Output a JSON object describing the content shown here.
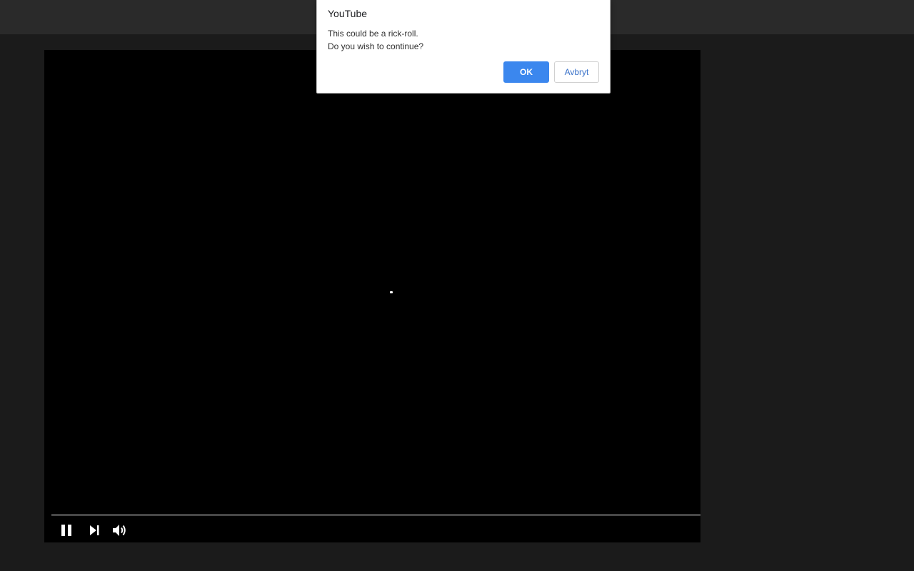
{
  "dialog": {
    "title": "YouTube",
    "message_line1": "This could be a rick-roll.",
    "message_line2": "Do you wish to continue?",
    "ok_label": "OK",
    "cancel_label": "Avbryt"
  },
  "player": {
    "progress_percent": 0,
    "controls": {
      "pause_icon": "pause-icon",
      "next_icon": "skip-next-icon",
      "volume_icon": "volume-icon"
    }
  },
  "colors": {
    "ok_button": "#3b87ee",
    "cancel_text": "#3871c9",
    "page_background": "#1b1b1b",
    "topbar": "#2a2a2a",
    "player_background": "#000000"
  }
}
